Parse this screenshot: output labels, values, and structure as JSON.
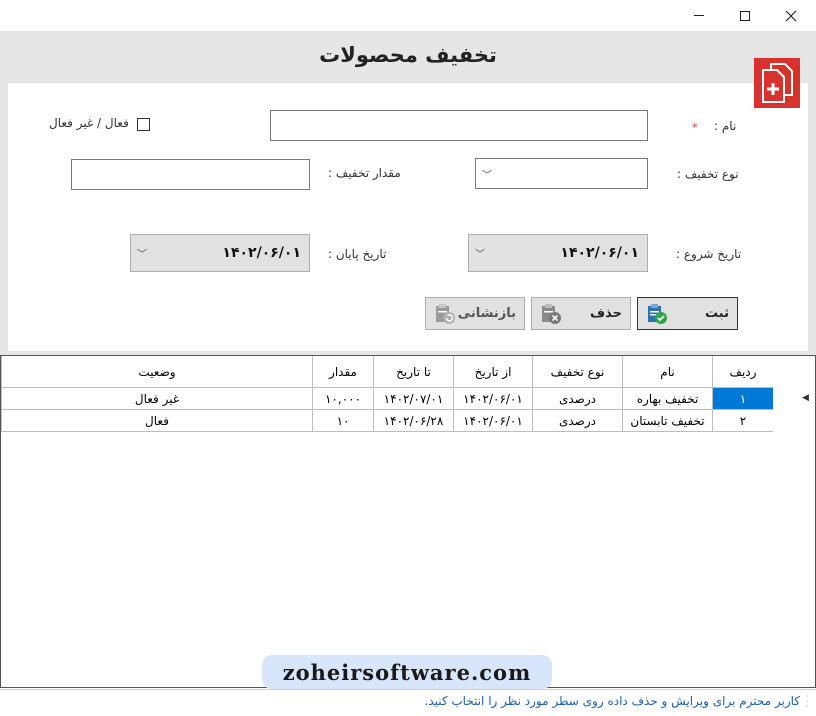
{
  "window": {
    "minimize_glyph": "—",
    "maximize_glyph": "☐",
    "close_glyph": "✕"
  },
  "page_title": "تخفیف  محصولات",
  "app_icon": "add-document-icon",
  "form": {
    "name_label": "نام :",
    "required_star": "*",
    "name_value": "",
    "active_label": "فعال / غیر فعال",
    "active_checked": false,
    "discount_type_label": "نوع تخفیف :",
    "discount_type_value": "",
    "discount_amount_label": "مقدار تخفیف :",
    "discount_amount_value": "",
    "start_date_label": "تاریخ شروع :",
    "start_date_value": "۱۴۰۲/۰۶/۰۱",
    "end_date_label": "تاریخ پایان :",
    "end_date_value": "۱۴۰۲/۰۶/۰۱"
  },
  "buttons": {
    "save": "ثبت",
    "delete": "حذف",
    "reset": "بازنشانی"
  },
  "grid": {
    "columns": [
      "ردیف",
      "نام",
      "نوع تخفیف",
      "از تاریخ",
      "تا تاریخ",
      "مقدار",
      "وضعیت"
    ],
    "rows": [
      {
        "radif": "۱",
        "name": "تخفیف بهاره",
        "type": "درصدی",
        "from": "۱۴۰۲/۰۶/۰۱",
        "to": "۱۴۰۲/۰۷/۰۱",
        "amount": "۱۰,۰۰۰",
        "status": "غیر فعال"
      },
      {
        "radif": "۲",
        "name": "تخفیف تابستان",
        "type": "درصدی",
        "from": "۱۴۰۲/۰۶/۰۱",
        "to": "۱۴۰۲/۰۶/۲۸",
        "amount": "۱۰",
        "status": "فعال"
      }
    ],
    "selected_row": 0
  },
  "watermark": "zoheirsoftware.com",
  "status_text": "کاربر محترم برای ویرایش و حذف داده روی سطر مورد نظر را انتخاب کنید.",
  "colors": {
    "accent": "#0078d7",
    "icon_red": "#d9312b",
    "status_blue": "#1c5fb0",
    "header_gray": "#e6e6e6"
  }
}
